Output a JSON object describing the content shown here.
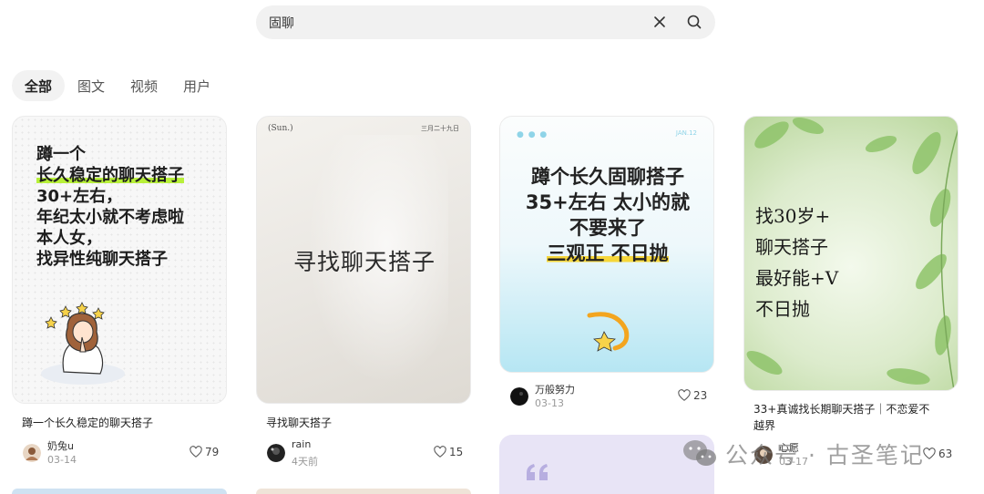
{
  "search": {
    "value": "固聊"
  },
  "tabs": [
    {
      "label": "全部",
      "active": true
    },
    {
      "label": "图文"
    },
    {
      "label": "视频"
    },
    {
      "label": "用户"
    }
  ],
  "cards": [
    {
      "cover_lines": [
        "蹲一个",
        "长久稳定的聊天搭子",
        "30+左右，",
        "年纪太小就不考虑啦",
        "本人女，",
        "找异性纯聊天搭子"
      ],
      "title": "蹲一个长久稳定的聊天搭子",
      "user": "奶兔u",
      "date": "03-14",
      "likes": "79"
    },
    {
      "cover_header_left": "(Sun.)",
      "cover_header_right": "三月二十九日",
      "cover_text": "寻找聊天搭子",
      "title": "寻找聊天搭子",
      "user": "rain",
      "date": "4天前",
      "likes": "15"
    },
    {
      "cover_header_right": "JAN.12",
      "cover_lines": [
        "蹲个长久固聊搭子",
        "35+左右 太小的就",
        "不要来了",
        "三观正 不日抛"
      ],
      "user": "万般努力",
      "date": "03-13",
      "likes": "23"
    },
    {
      "cover_lines": [
        "找30岁+",
        "聊天搭子",
        "最好能+V",
        "不日抛"
      ],
      "title_line1": "33+真诚找长期聊天搭子｜不恋爱不",
      "title_line2": "越界",
      "user": "心愿",
      "date": "03-17",
      "likes": "63"
    }
  ],
  "watermark": "公众号 · 古圣笔记",
  "colors": {
    "accent_green": "#b8f03a",
    "accent_yellow": "#f6d73a",
    "tab_bg": "#f2f2f2"
  }
}
